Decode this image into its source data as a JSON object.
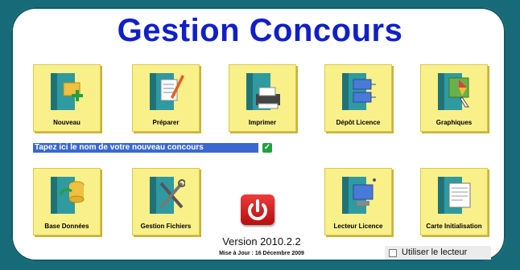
{
  "app": {
    "title": "Gestion Concours"
  },
  "tiles": {
    "nouveau": {
      "label": "Nouveau",
      "icon": "folder-add-icon"
    },
    "preparer": {
      "label": "Préparer",
      "icon": "folder-edit-icon"
    },
    "imprimer": {
      "label": "Imprimer",
      "icon": "folder-printer-icon"
    },
    "depot_licence": {
      "label": "Dépôt Licence",
      "icon": "folder-network-icon"
    },
    "graphiques": {
      "label": "Graphiques",
      "icon": "folder-chart-icon"
    },
    "base_donnees": {
      "label": "Base Données",
      "icon": "folder-database-icon"
    },
    "gestion_fichiers": {
      "label": "Gestion Fichiers",
      "icon": "folder-tools-icon"
    },
    "lecteur_licence": {
      "label": "Lecteur Licence",
      "icon": "folder-reader-icon"
    },
    "carte_initialisation": {
      "label": "Carte Initialisation",
      "icon": "folder-card-icon"
    }
  },
  "contest_input": {
    "value": "Tapez ici le nom de votre nouveau concours"
  },
  "power": {
    "icon": "power-icon"
  },
  "footer": {
    "version": "Version 2010.2.2",
    "update": "Mise à Jour : 16 Décembre 2009"
  },
  "reader_option": {
    "label": "Utiliser le lecteur",
    "checked": false
  },
  "colors": {
    "background": "#176b78",
    "title": "#1020c8",
    "tile": "#faf08a",
    "folder": "#2f9aa0",
    "power": "#d42020"
  }
}
